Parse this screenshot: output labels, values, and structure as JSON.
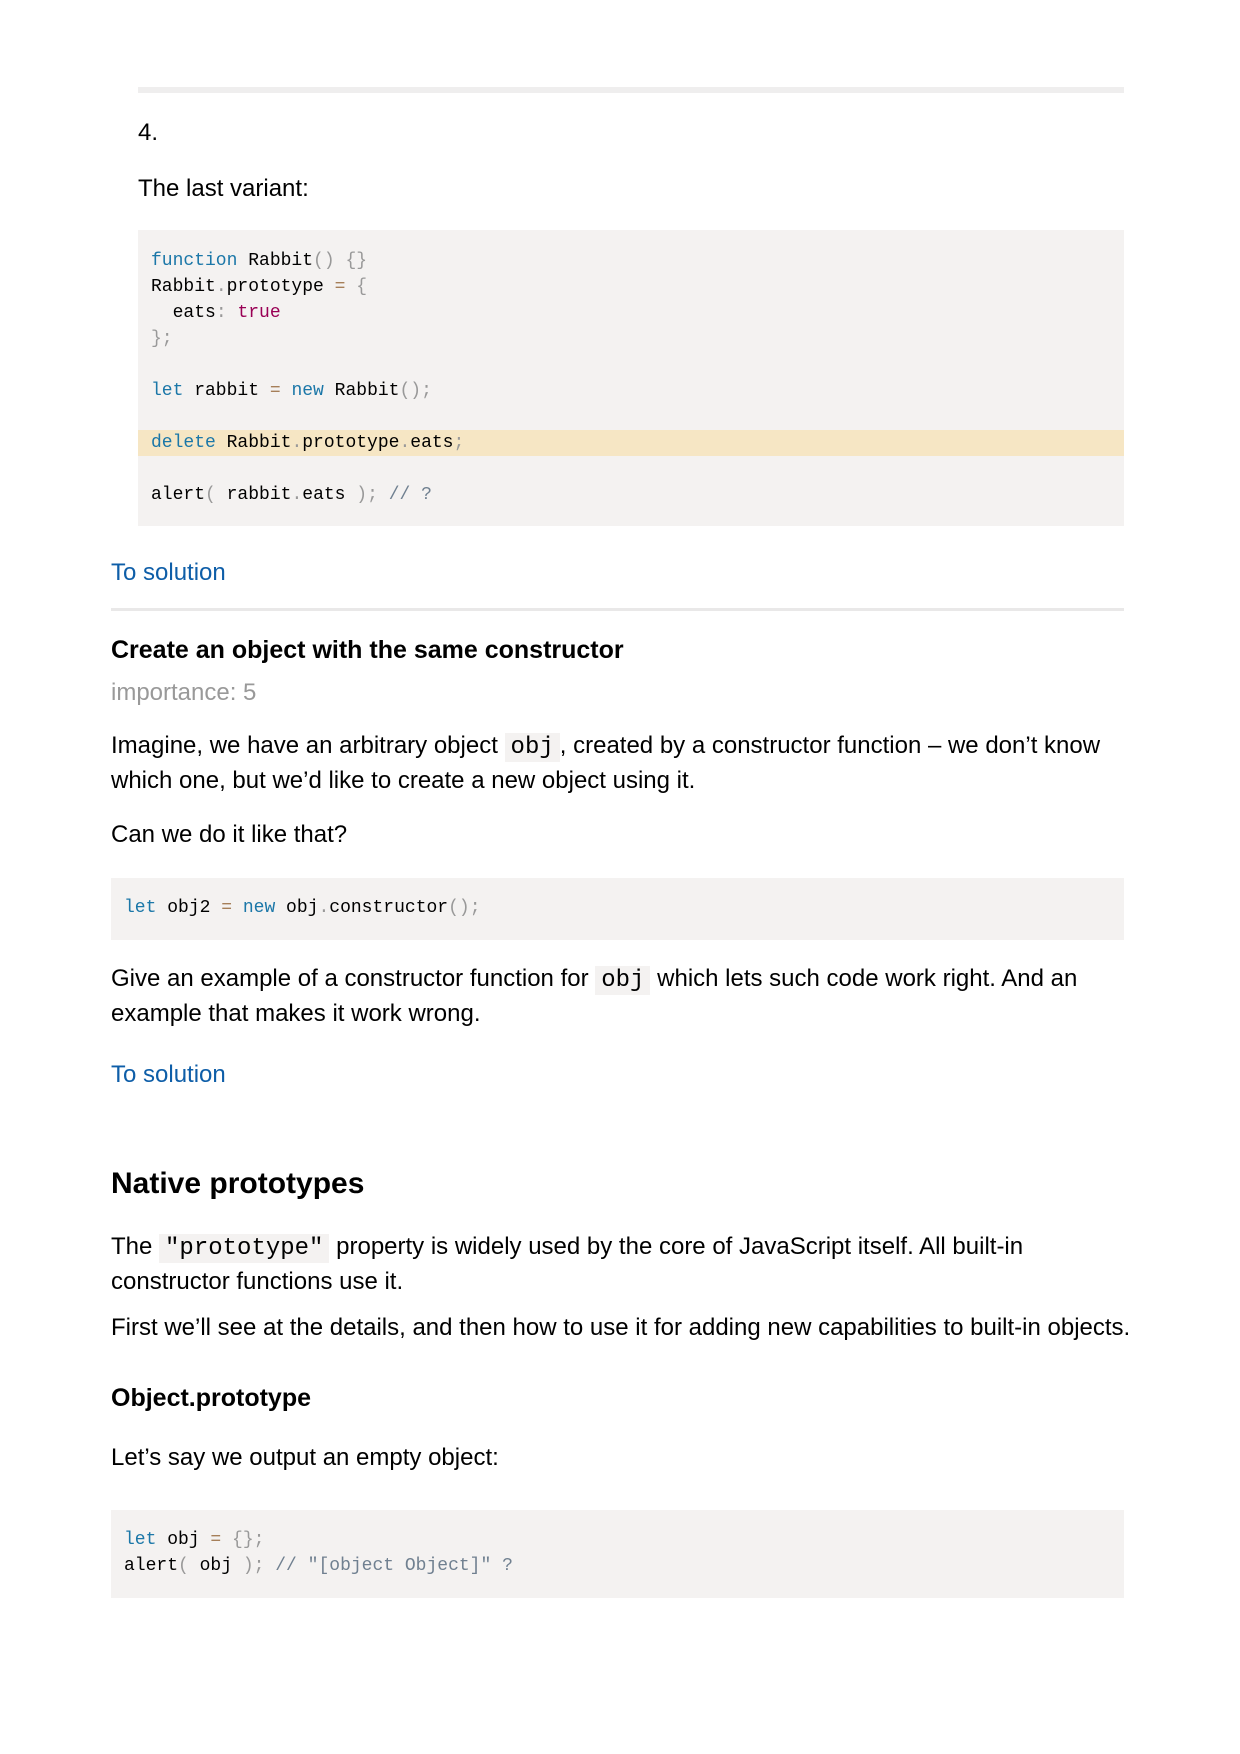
{
  "task4": {
    "number": "4.",
    "intro": "The last variant:",
    "code": [
      [
        {
          "t": "function",
          "c": "kw"
        },
        {
          "t": " Rabbit"
        },
        {
          "t": "() {}",
          "c": "pun"
        }
      ],
      [
        {
          "t": "Rabbit"
        },
        {
          "t": ".",
          "c": "pun"
        },
        {
          "t": "prototype "
        },
        {
          "t": "=",
          "c": "op"
        },
        {
          "t": " {",
          "c": "pun"
        }
      ],
      [
        {
          "t": "  eats"
        },
        {
          "t": ":",
          "c": "pun"
        },
        {
          "t": " "
        },
        {
          "t": "true",
          "c": "bool"
        }
      ],
      [
        {
          "t": "};",
          "c": "pun"
        }
      ],
      [],
      [
        {
          "t": "let",
          "c": "kw"
        },
        {
          "t": " rabbit "
        },
        {
          "t": "=",
          "c": "op"
        },
        {
          "t": " "
        },
        {
          "t": "new",
          "c": "kw"
        },
        {
          "t": " Rabbit"
        },
        {
          "t": "();",
          "c": "pun"
        }
      ],
      [],
      [
        {
          "t": "delete",
          "c": "kw"
        },
        {
          "t": " Rabbit"
        },
        {
          "t": ".",
          "c": "pun"
        },
        {
          "t": "prototype"
        },
        {
          "t": ".",
          "c": "pun"
        },
        {
          "t": "eats"
        },
        {
          "t": ";",
          "c": "pun"
        }
      ],
      [],
      [
        {
          "t": "alert"
        },
        {
          "t": "(",
          "c": "pun"
        },
        {
          "t": " rabbit"
        },
        {
          "t": ".",
          "c": "pun"
        },
        {
          "t": "eats "
        },
        {
          "t": ");",
          "c": "pun"
        },
        {
          "t": " // ?",
          "c": "cm"
        }
      ]
    ],
    "highlighted_line": 7,
    "solution_link": "To solution"
  },
  "task_constructor": {
    "title": "Create an object with the same constructor",
    "importance": "importance: 5",
    "p1_before": "Imagine, we have an arbitrary object ",
    "p1_code": "obj",
    "p1_after": ", created by a constructor function – we don’t know which one, but we’d like to create a new object using it.",
    "p2": "Can we do it like that?",
    "code": [
      [
        {
          "t": "let",
          "c": "kw"
        },
        {
          "t": " obj2 "
        },
        {
          "t": "=",
          "c": "op"
        },
        {
          "t": " "
        },
        {
          "t": "new",
          "c": "kw"
        },
        {
          "t": " obj"
        },
        {
          "t": ".",
          "c": "pun"
        },
        {
          "t": "constructor"
        },
        {
          "t": "();",
          "c": "pun"
        }
      ]
    ],
    "p3_before": "Give an example of a constructor function for ",
    "p3_code": "obj",
    "p3_after": " which lets such code work right. And an example that makes it work wrong.",
    "solution_link": "To solution"
  },
  "native": {
    "title": "Native prototypes",
    "p1_before": "The ",
    "p1_code": "\"prototype\"",
    "p1_after": " property is widely used by the core of JavaScript itself. All built-in constructor functions use it.",
    "p2": "First we’ll see at the details, and then how to use it for adding new capabilities to built-in objects."
  },
  "object_prototype": {
    "title": "Object.prototype",
    "p1": "Let’s say we output an empty object:",
    "code": [
      [
        {
          "t": "let",
          "c": "kw"
        },
        {
          "t": " obj "
        },
        {
          "t": "=",
          "c": "op"
        },
        {
          "t": " {};",
          "c": "pun"
        }
      ],
      [
        {
          "t": "alert"
        },
        {
          "t": "(",
          "c": "pun"
        },
        {
          "t": " obj "
        },
        {
          "t": ");",
          "c": "pun"
        },
        {
          "t": " // \"[object Object]\" ?",
          "c": "cm"
        }
      ]
    ]
  }
}
